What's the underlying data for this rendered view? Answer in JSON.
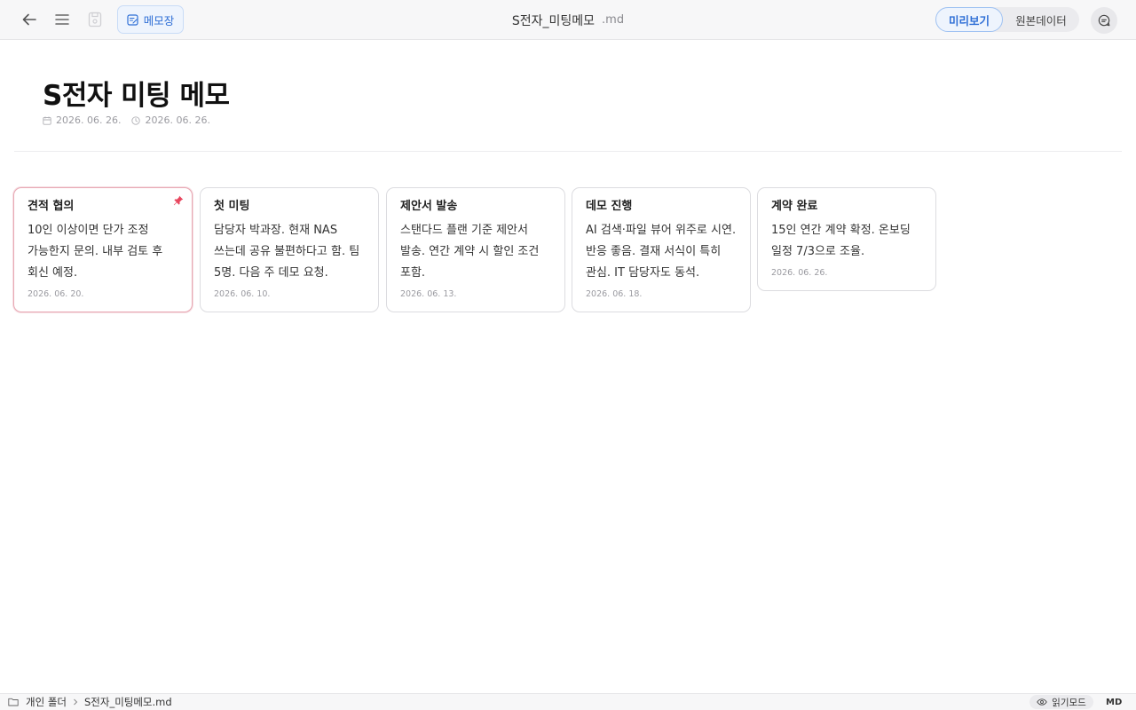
{
  "toolbar": {
    "memo_label": "메모장",
    "doc_name": "S전자_미팅메모",
    "doc_ext": ".md",
    "view_modes": [
      "미리보기",
      "원본데이터"
    ]
  },
  "page": {
    "title": "S전자 미팅 메모",
    "created": "2026. 06. 26.",
    "modified": "2026. 06. 26."
  },
  "cards": [
    {
      "title": "견적 협의",
      "body": "10인 이상이면 단가 조정 가능한지 문의. 내부 검토 후 회신 예정.",
      "date": "2026. 06. 20.",
      "pinned": true
    },
    {
      "title": "첫 미팅",
      "body": "담당자 박과장. 현재 NAS 쓰는데 공유 불편하다고 함. 팀 5명. 다음 주 데모 요청.",
      "date": "2026. 06. 10.",
      "pinned": false
    },
    {
      "title": "제안서 발송",
      "body": "스탠다드 플랜 기준 제안서 발송. 연간 계약 시 할인 조건 포함.",
      "date": "2026. 06. 13.",
      "pinned": false
    },
    {
      "title": "데모 진행",
      "body": "AI 검색·파일 뷰어 위주로 시연. 반응 좋음. 결재 서식이 특히 관심. IT 담당자도 동석.",
      "date": "2026. 06. 18.",
      "pinned": false
    },
    {
      "title": "계약 완료",
      "body": "15인 연간 계약 확정. 온보딩 일정 7/3으로 조율.",
      "date": "2026. 06. 26.",
      "pinned": false
    }
  ],
  "statusbar": {
    "folder": "개인 폴더",
    "file": "S전자_미팅메모.md",
    "read_mode": "읽기모드",
    "format": "MD"
  },
  "colors": {
    "accent": "#2f6fd6",
    "pin": "#e8475f",
    "pinned_border": "#e8a9b4"
  }
}
